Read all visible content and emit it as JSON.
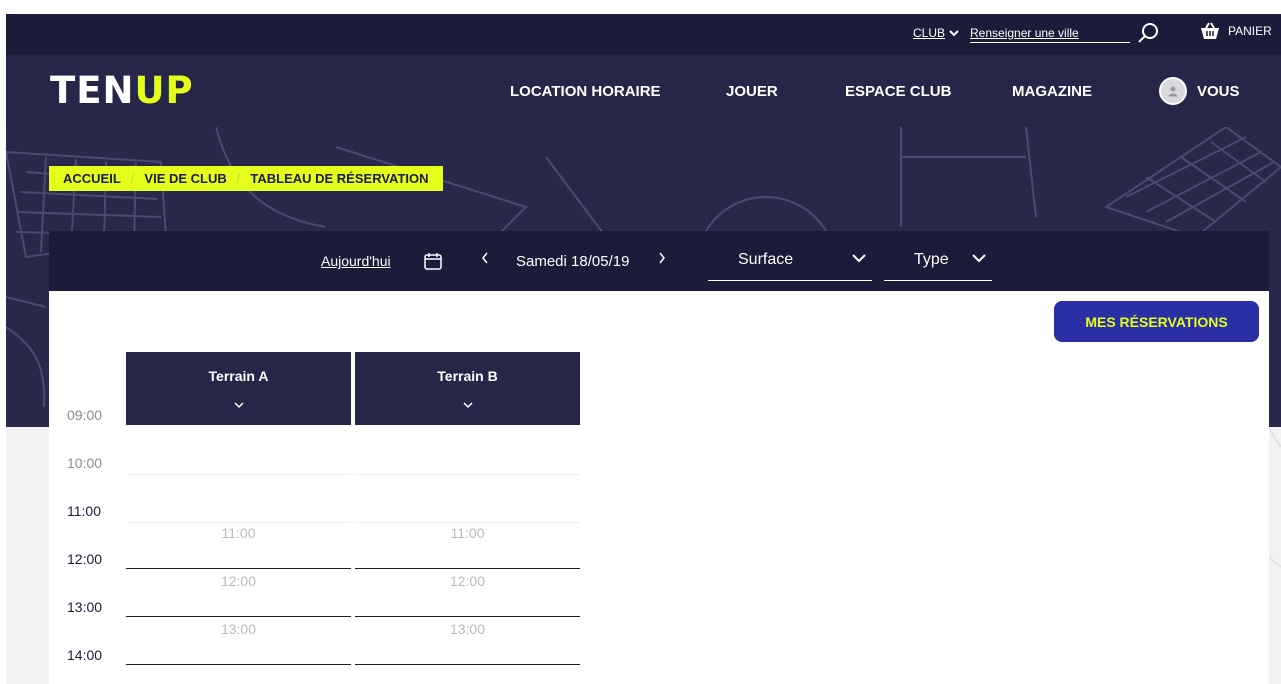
{
  "topbar": {
    "club_label": "CLUB",
    "city_placeholder": "Renseigner une ville",
    "cart_label": "PANIER"
  },
  "nav": {
    "logo_ten": "TEN",
    "logo_up": "UP",
    "items": [
      "LOCATION HORAIRE",
      "JOUER",
      "ESPACE CLUB",
      "MAGAZINE"
    ],
    "user_label": "VOUS"
  },
  "breadcrumb": [
    "ACCUEIL",
    "VIE DE CLUB",
    "TABLEAU DE RÉSERVATION"
  ],
  "filters": {
    "today": "Aujourd'hui",
    "date": "Samedi 18/05/19",
    "surface": "Surface",
    "type": "Type"
  },
  "reservations_button": "MES RÉSERVATIONS",
  "courts": [
    "Terrain A",
    "Terrain B"
  ],
  "hours": [
    "09:00",
    "10:00",
    "11:00",
    "12:00",
    "13:00",
    "14:00"
  ],
  "slots": [
    "11:00",
    "12:00",
    "13:00"
  ],
  "colors": {
    "navy": "#1b1b3a",
    "nav_bg": "#262648",
    "accent_yellow": "#e4ff1b",
    "button_blue": "#2a2fa6"
  }
}
